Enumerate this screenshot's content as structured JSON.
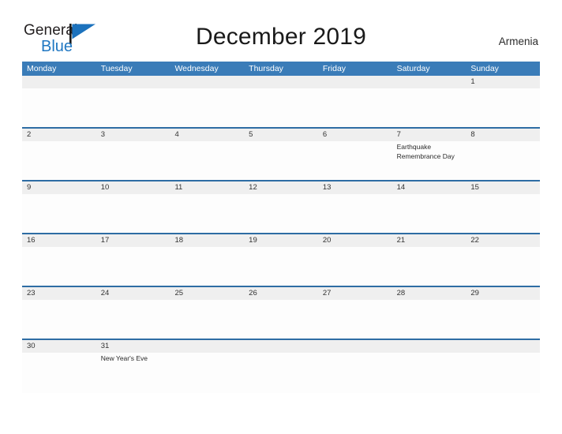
{
  "brand": {
    "name_part1": "General",
    "name_part2": "Blue",
    "flag_icon": "blue-flag-icon",
    "colors": {
      "general_text": "#231f20",
      "blue_text": "#1f77c2",
      "flag": "#1c72bd"
    }
  },
  "header": {
    "title": "December 2019",
    "country": "Armenia"
  },
  "theme": {
    "header_bar": "#3a7cb8",
    "row_divider": "#2e6da4",
    "date_band": "#efefef",
    "cell_background": "#fdfdfd",
    "weekday_text": "#ffffff",
    "date_text": "#333333",
    "event_text": "#2b2b2b"
  },
  "calendar": {
    "month": "December",
    "year": "2019",
    "weekdays": [
      "Monday",
      "Tuesday",
      "Wednesday",
      "Thursday",
      "Friday",
      "Saturday",
      "Sunday"
    ],
    "weeks": [
      {
        "days": [
          {
            "date": "",
            "event": ""
          },
          {
            "date": "",
            "event": ""
          },
          {
            "date": "",
            "event": ""
          },
          {
            "date": "",
            "event": ""
          },
          {
            "date": "",
            "event": ""
          },
          {
            "date": "",
            "event": ""
          },
          {
            "date": "1",
            "event": ""
          }
        ]
      },
      {
        "days": [
          {
            "date": "2",
            "event": ""
          },
          {
            "date": "3",
            "event": ""
          },
          {
            "date": "4",
            "event": ""
          },
          {
            "date": "5",
            "event": ""
          },
          {
            "date": "6",
            "event": ""
          },
          {
            "date": "7",
            "event": "Earthquake Remembrance Day"
          },
          {
            "date": "8",
            "event": ""
          }
        ]
      },
      {
        "days": [
          {
            "date": "9",
            "event": ""
          },
          {
            "date": "10",
            "event": ""
          },
          {
            "date": "11",
            "event": ""
          },
          {
            "date": "12",
            "event": ""
          },
          {
            "date": "13",
            "event": ""
          },
          {
            "date": "14",
            "event": ""
          },
          {
            "date": "15",
            "event": ""
          }
        ]
      },
      {
        "days": [
          {
            "date": "16",
            "event": ""
          },
          {
            "date": "17",
            "event": ""
          },
          {
            "date": "18",
            "event": ""
          },
          {
            "date": "19",
            "event": ""
          },
          {
            "date": "20",
            "event": ""
          },
          {
            "date": "21",
            "event": ""
          },
          {
            "date": "22",
            "event": ""
          }
        ]
      },
      {
        "days": [
          {
            "date": "23",
            "event": ""
          },
          {
            "date": "24",
            "event": ""
          },
          {
            "date": "25",
            "event": ""
          },
          {
            "date": "26",
            "event": ""
          },
          {
            "date": "27",
            "event": ""
          },
          {
            "date": "28",
            "event": ""
          },
          {
            "date": "29",
            "event": ""
          }
        ]
      },
      {
        "days": [
          {
            "date": "30",
            "event": ""
          },
          {
            "date": "31",
            "event": "New Year's Eve"
          },
          {
            "date": "",
            "event": ""
          },
          {
            "date": "",
            "event": ""
          },
          {
            "date": "",
            "event": ""
          },
          {
            "date": "",
            "event": ""
          },
          {
            "date": "",
            "event": ""
          }
        ]
      }
    ]
  }
}
